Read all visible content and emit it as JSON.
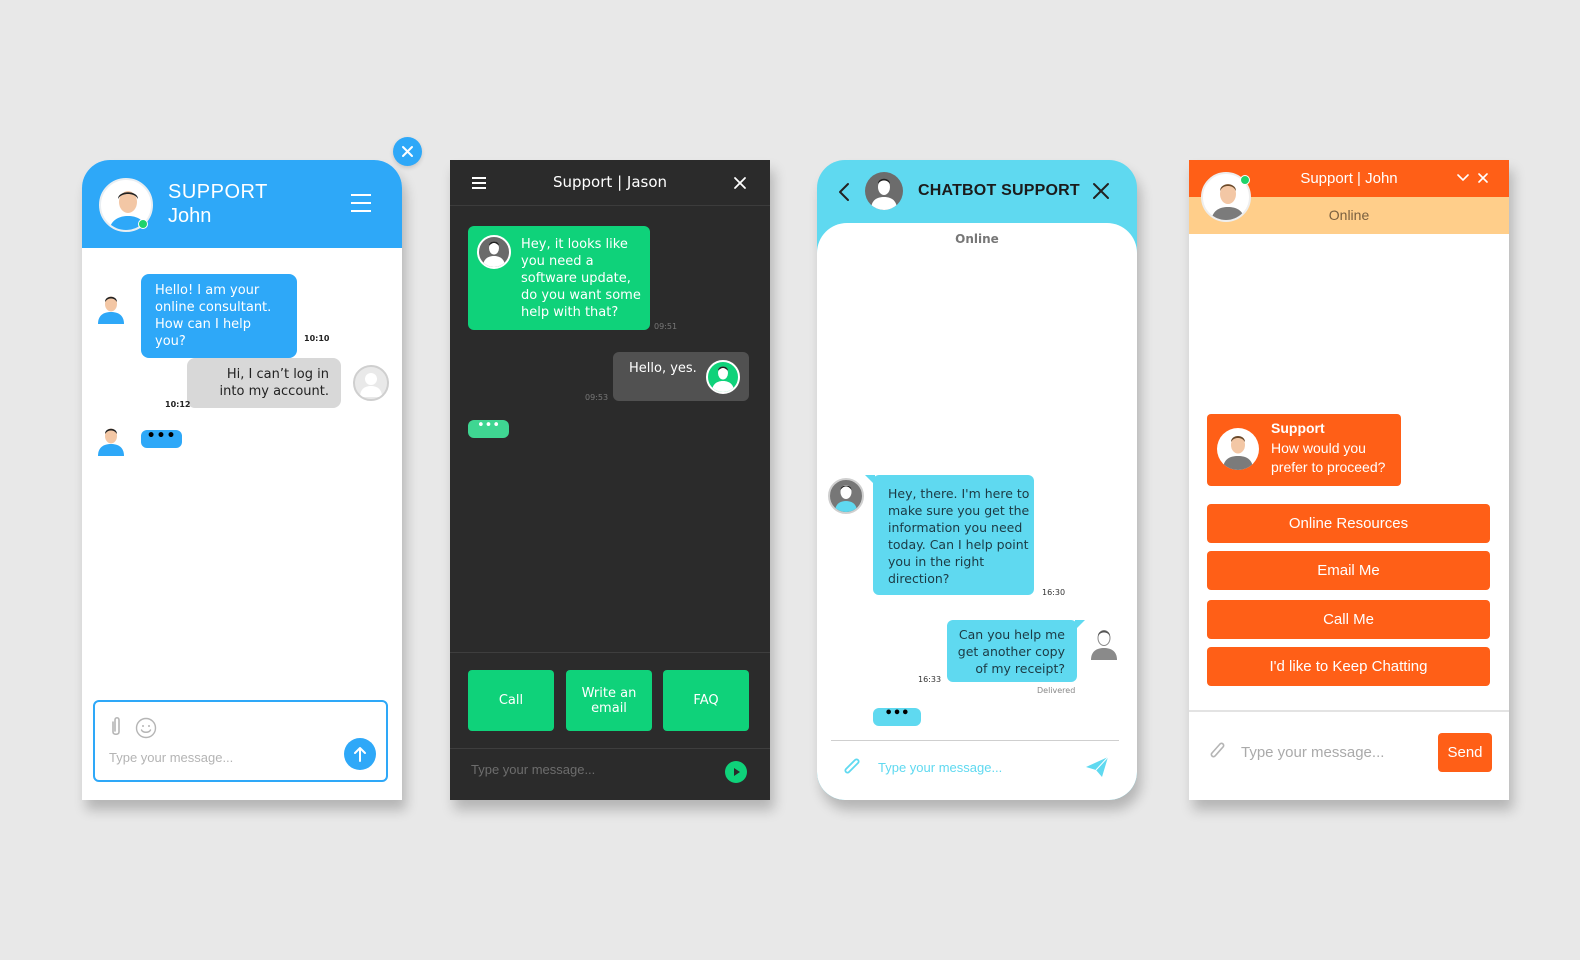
{
  "colors": {
    "blue": "#2ea8f8",
    "dark": "#2b2b2b",
    "green": "#0fd27a",
    "cyan": "#5fd9f0",
    "orange": "#ff5f17",
    "peach": "#ffce8a",
    "online": "#1fd36a"
  },
  "panel_blue": {
    "header_title": "SUPPORT",
    "header_name": "John",
    "messages": [
      {
        "from": "agent",
        "text": "Hello! I am your online consultant. How can I help you?",
        "time": "10:10"
      },
      {
        "from": "user",
        "text": "Hi, I can’t log in into my account.",
        "time": "10:12"
      }
    ],
    "typing": "•••",
    "input_placeholder": "Type your message...",
    "icons": [
      "user-avatar-icon",
      "menu-icon",
      "close-icon",
      "paperclip-icon",
      "smile-icon",
      "arrow-up-icon"
    ]
  },
  "panel_dark": {
    "header_support": "Support",
    "header_name": "Jason",
    "messages": [
      {
        "from": "agent",
        "text": "Hey, it looks like you need a software update, do you want some help with that?",
        "time": "09:51"
      },
      {
        "from": "user",
        "text": "Hello, yes.",
        "time": "09:53"
      }
    ],
    "typing": "•••",
    "quick_actions": [
      "Call",
      "Write an email",
      "FAQ"
    ],
    "input_placeholder": "Type your message...",
    "icons": [
      "menu-icon",
      "close-icon",
      "play-send-icon"
    ]
  },
  "panel_cyan": {
    "header_title": "CHATBOT SUPPORT",
    "status": "Online",
    "messages": [
      {
        "from": "agent",
        "text": "Hey, there. I'm here to make sure you get the information you need today. Can I help point you in the right direction?",
        "time": "16:30"
      },
      {
        "from": "user",
        "text": "Can you help me get another copy of my receipt?",
        "time": "16:33",
        "status": "Delivered"
      }
    ],
    "typing": "•••",
    "input_placeholder": "Type your message...",
    "icons": [
      "back-chevron-icon",
      "close-icon",
      "paperclip-icon",
      "paper-plane-icon"
    ]
  },
  "panel_orange": {
    "header_support": "Support",
    "header_name": "John",
    "status": "Online",
    "message_title": "Support",
    "message_text": "How would you prefer to proceed?",
    "options": [
      "Online Resources",
      "Email Me",
      "Call Me",
      "I'd like to Keep Chatting"
    ],
    "input_placeholder": "Type your message...",
    "send_label": "Send",
    "icons": [
      "chevron-down-icon",
      "close-icon",
      "paperclip-icon"
    ]
  }
}
